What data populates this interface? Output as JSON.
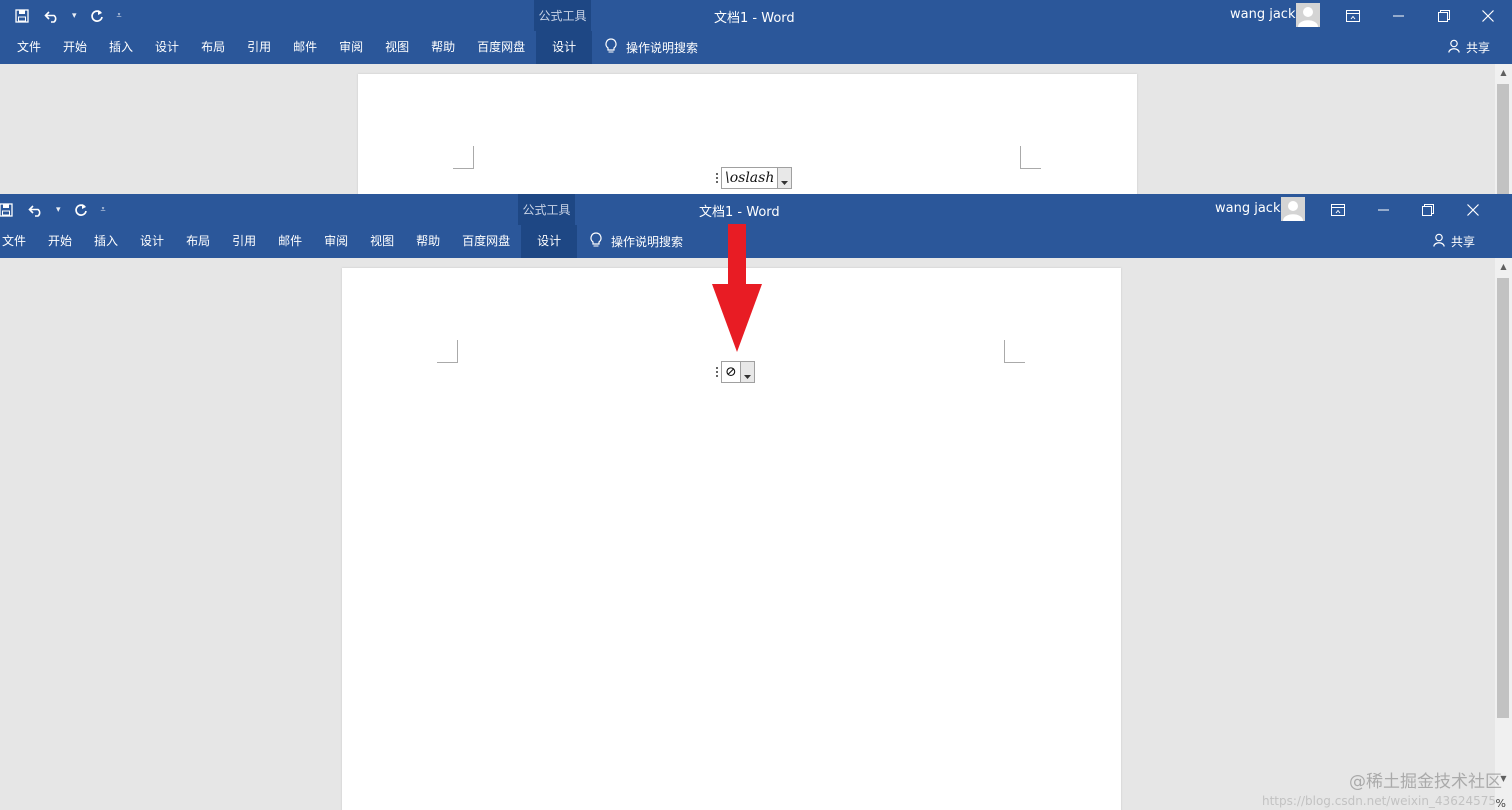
{
  "windows": [
    {
      "id": "before",
      "context_tab_label": "公式工具",
      "doc_title": "文档1  -  Word",
      "user_name": "wang jack",
      "ribbon_tabs": [
        "文件",
        "开始",
        "插入",
        "设计",
        "布局",
        "引用",
        "邮件",
        "审阅",
        "视图",
        "帮助",
        "百度网盘",
        "设计"
      ],
      "tell_me": "操作说明搜索",
      "share": "共享",
      "equation_text": "\\oslash"
    },
    {
      "id": "after",
      "context_tab_label": "公式工具",
      "doc_title": "文档1  -  Word",
      "user_name": "wang jack",
      "ribbon_tabs": [
        "文件",
        "开始",
        "插入",
        "设计",
        "布局",
        "引用",
        "邮件",
        "审阅",
        "视图",
        "帮助",
        "百度网盘",
        "设计"
      ],
      "tell_me": "操作说明搜索",
      "share": "共享",
      "equation_text": "⊘"
    }
  ],
  "colors": {
    "ribbon": "#2b579a",
    "ribbon_active": "#1e4784",
    "annotation_arrow": "#e81c24"
  },
  "icons": [
    "save-icon",
    "undo-icon",
    "redo-icon",
    "customize-qat-icon",
    "user-avatar-icon",
    "ribbon-display-options-icon",
    "minimize-icon",
    "restore-icon",
    "close-icon",
    "lightbulb-icon",
    "share-person-icon"
  ],
  "watermark": {
    "text": "@稀土掘金技术社区",
    "url": "https://blog.csdn.net/weixin_43624575"
  },
  "zoom_indicator": "%"
}
